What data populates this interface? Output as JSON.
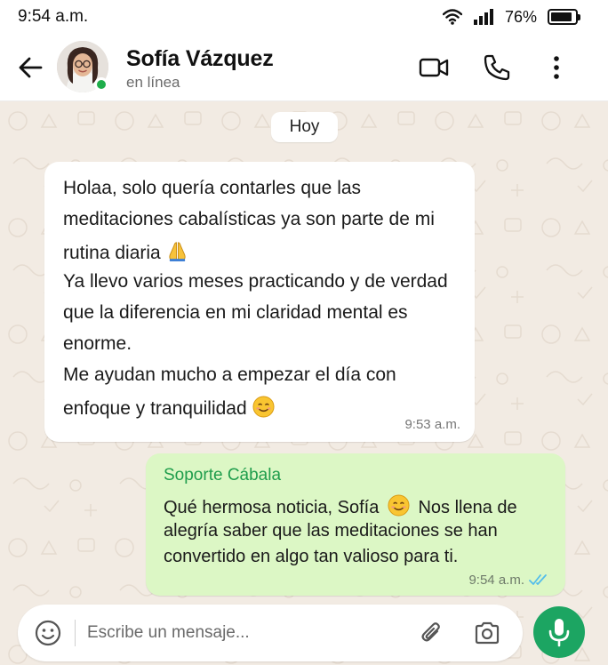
{
  "status_bar": {
    "time": "9:54 a.m.",
    "battery_text": "76%",
    "battery_level": 0.76
  },
  "header": {
    "contact_name": "Sofía Vázquez",
    "contact_status": "en línea",
    "online_color": "#1fae4b"
  },
  "chat": {
    "day_chip": "Hoy",
    "incoming": {
      "lines": [
        "Holaa, solo quería contarles que las",
        "meditaciones cabalísticas ya son parte de mi",
        "rutina diaria",
        "Ya llevo varios meses practicando y de verdad",
        "que la diferencia en mi claridad mental es",
        "enorme.",
        "Me ayudan mucho a empezar el día con",
        "enfoque y tranquilidad"
      ],
      "time": "9:53 a.m."
    },
    "outgoing": {
      "sender": "Soporte Cábala",
      "lines": [
        "Qué hermosa noticia, Sofía",
        "Nos llena de",
        "alegría saber que las meditaciones se han",
        "convertido en algo tan valioso para ti."
      ],
      "time": "9:54 a.m.",
      "read_color": "#53bdeb"
    }
  },
  "composer": {
    "placeholder": "Escribe un mensaje..."
  },
  "icons": {
    "back": "arrow-left-icon",
    "video": "video-camera-icon",
    "call": "phone-icon",
    "menu": "more-vertical-icon",
    "emoji": "emoji-icon",
    "attach": "paperclip-icon",
    "camera": "camera-icon",
    "mic": "microphone-icon",
    "pray_emoji": "folded-hands-emoji",
    "smile_emoji": "smiling-face-emoji"
  },
  "colors": {
    "accent_green": "#1ca562",
    "outgoing_bubble": "#dcf7c5",
    "chat_background": "#f2ebe3"
  }
}
